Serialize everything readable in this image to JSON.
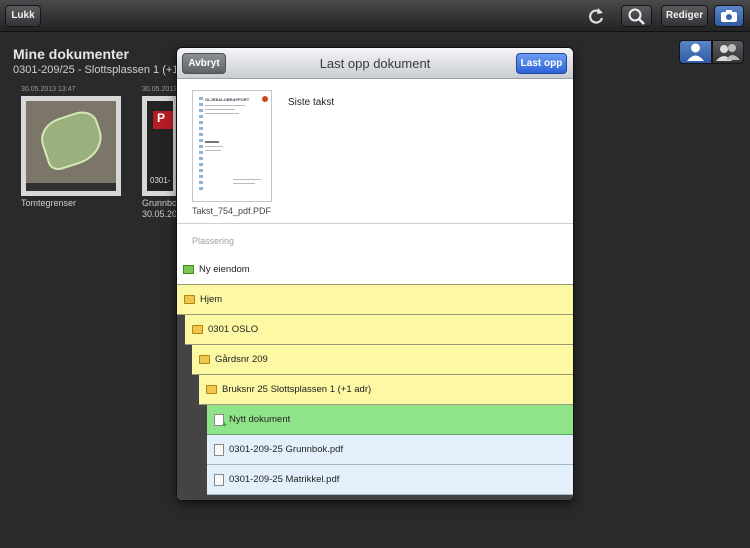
{
  "toolbar": {
    "close_label": "Lukk",
    "edit_label": "Rediger",
    "refresh_icon": "refresh-icon",
    "search_icon": "search-icon",
    "camera_icon": "camera-icon"
  },
  "background": {
    "title": "Mine dokumenter",
    "subtitle": "0301-209/25 - Slottsplassen 1 (+1",
    "segments": [
      "person-icon",
      "group-icon"
    ],
    "documents": [
      {
        "date": "30.05.2013 13:47",
        "name": "Tomtegrenser",
        "thumb_icon": "map-thumbnail"
      },
      {
        "date": "30.05.2013",
        "name": "Grunnbok",
        "name_line2": "30.05.20",
        "thumb_caption": "0301-",
        "thumb_band": "P"
      }
    ]
  },
  "modal": {
    "title": "Last opp dokument",
    "cancel_label": "Avbryt",
    "upload_label": "Last opp",
    "document": {
      "preview_heading": "OLJEBALOBRAPPORT",
      "filename": "Takst_754_pdf.PDF",
      "label": "Siste takst"
    },
    "location_label": "Plassering",
    "corner_mark": "π",
    "tree": [
      {
        "label": "Ny eiendom",
        "type": "new-property",
        "icon": "new-property-icon"
      },
      {
        "label": "Hjem",
        "type": "folder",
        "icon": "folder-icon"
      },
      {
        "label": "0301 OSLO",
        "type": "folder",
        "icon": "folder-icon"
      },
      {
        "label": "Gårdsnr 209",
        "type": "folder",
        "icon": "folder-icon"
      },
      {
        "label": "Bruksnr 25 Slottsplassen 1 (+1 adr)",
        "type": "folder",
        "icon": "folder-icon"
      },
      {
        "label": "Nytt dokument",
        "type": "new-document",
        "icon": "new-document-icon"
      },
      {
        "label": "0301-209-25 Grunnbok.pdf",
        "type": "file",
        "icon": "pdf-file-icon"
      },
      {
        "label": "0301-209-25 Matrikkel.pdf",
        "type": "file",
        "icon": "pdf-file-icon"
      }
    ]
  },
  "colors": {
    "folder_row": "#fcf8a3",
    "new_document_row": "#8fe489",
    "file_row": "#e3f0fb",
    "primary_button": "#2c62d6"
  }
}
